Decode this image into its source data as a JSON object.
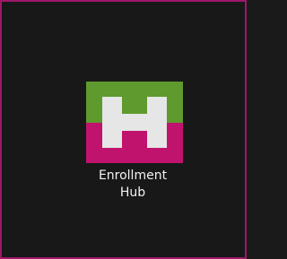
{
  "desktop": {
    "frame_color": "#9c1868",
    "background_color": "#181818"
  },
  "app": {
    "icon": "enrollment-hub-logo-icon",
    "label_line1": "Enrollment",
    "label_line2": "Hub",
    "colors": {
      "top": "#5e9a2e",
      "bottom": "#c0136e",
      "letter": "#e6e6e6"
    }
  }
}
